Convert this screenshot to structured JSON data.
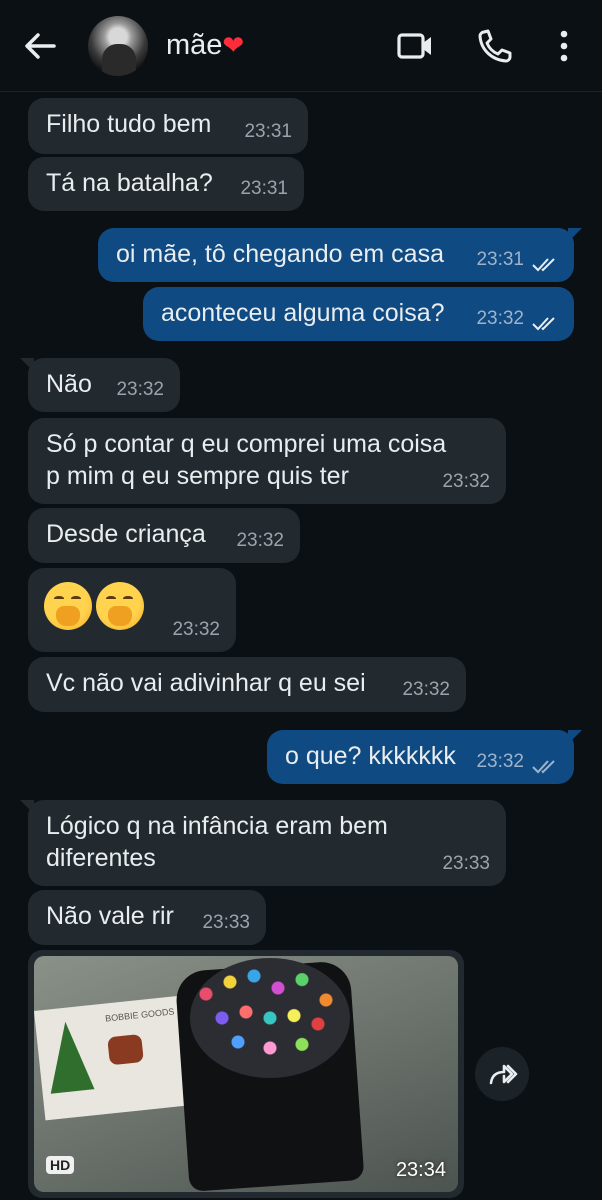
{
  "header": {
    "contact_name": "mãe",
    "contact_heart": "❤",
    "icons": [
      "back-arrow-icon",
      "avatar",
      "video-camera-icon",
      "phone-icon",
      "more-vertical-icon"
    ]
  },
  "messages": [
    {
      "dir": "in",
      "text": "Filho tudo bem",
      "time": "23:31"
    },
    {
      "dir": "in",
      "text": "Tá na batalha?",
      "time": "23:31"
    },
    {
      "dir": "out",
      "text": "oi mãe, tô chegando em casa",
      "time": "23:31",
      "status": "read"
    },
    {
      "dir": "out",
      "text": "aconteceu alguma coisa?",
      "time": "23:32",
      "status": "read"
    },
    {
      "dir": "in",
      "text": "Não",
      "time": "23:32"
    },
    {
      "dir": "in",
      "text": "Só p contar q eu comprei uma coisa",
      "text2": "p mim q eu sempre quis ter",
      "time": "23:32"
    },
    {
      "dir": "in",
      "text": "Desde criança",
      "time": "23:32"
    },
    {
      "dir": "in",
      "emoji": "face-with-hand-over-mouth x2",
      "time": "23:32"
    },
    {
      "dir": "in",
      "text": "Vc não vai adivinhar q eu sei",
      "time": "23:32"
    },
    {
      "dir": "out",
      "text": "o que? kkkkkkk",
      "time": "23:32",
      "status": "delivered"
    },
    {
      "dir": "in",
      "text": "Lógico q na infância eram bem",
      "text2": "diferentes",
      "time": "23:33"
    },
    {
      "dir": "in",
      "text": "Não vale rir",
      "time": "23:33"
    }
  ],
  "photo_message": {
    "badge": "HD",
    "time": "23:34",
    "book_text": "BOBBIE GOODS"
  },
  "colors": {
    "background": "#0b1014",
    "incoming_bubble": "#232a2f",
    "outgoing_bubble": "#0f4a83",
    "read_ticks": "#e9edef"
  }
}
